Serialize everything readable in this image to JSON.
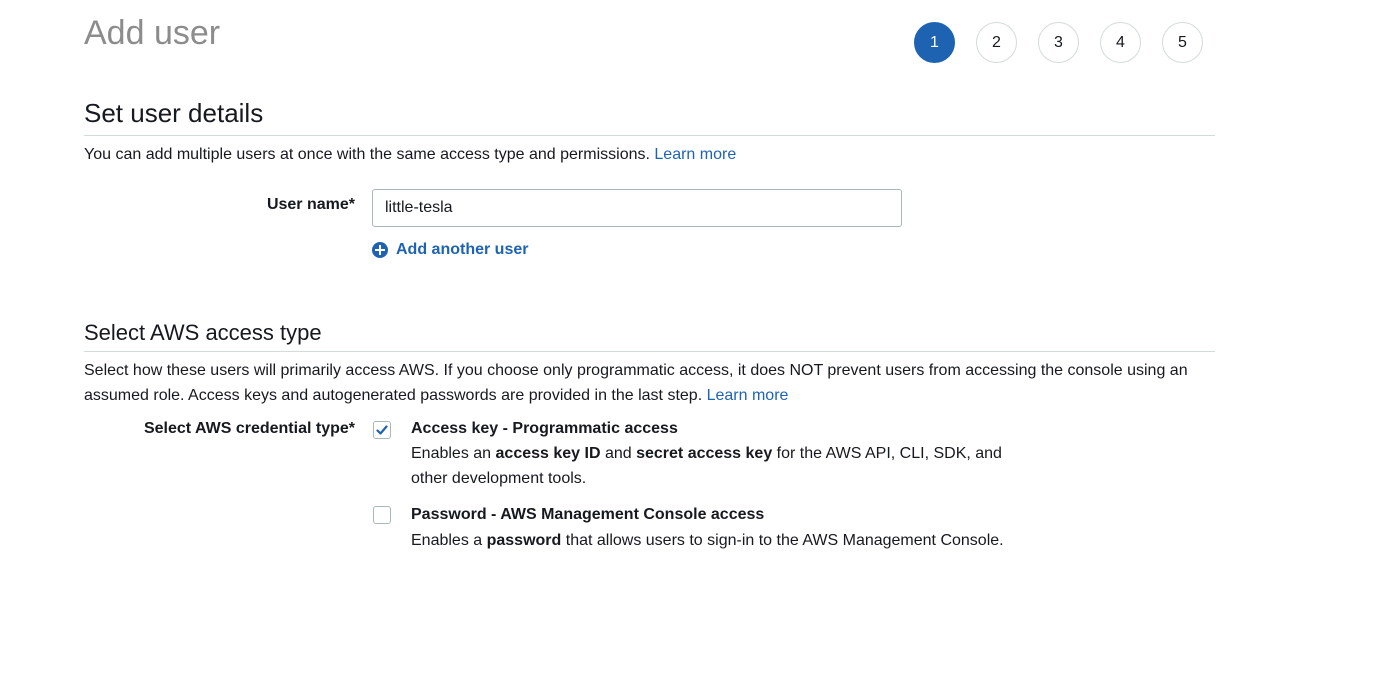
{
  "page": {
    "title": "Add user"
  },
  "steps": [
    "1",
    "2",
    "3",
    "4",
    "5"
  ],
  "active_step": 1,
  "details": {
    "heading": "Set user details",
    "description": "You can add multiple users at once with the same access type and permissions.",
    "learn_more": "Learn more",
    "user_name_label": "User name*",
    "user_name_value": "little-tesla",
    "add_another_user": "Add another user"
  },
  "access": {
    "heading": "Select AWS access type",
    "description": "Select how these users will primarily access AWS. If you choose only programmatic access, it does NOT prevent users from accessing the console using an assumed role. Access keys and autogenerated passwords are provided in the last step.",
    "learn_more": "Learn more",
    "credential_label": "Select AWS credential type*",
    "options": [
      {
        "title": "Access key - Programmatic access",
        "checked": true,
        "desc_1": "Enables an ",
        "desc_bold_1": "access key ID",
        "desc_2": " and ",
        "desc_bold_2": "secret access key",
        "desc_3": " for the AWS API, CLI, SDK, and",
        "desc_line2": "other development tools."
      },
      {
        "title": "Password - AWS Management Console access",
        "checked": false,
        "desc_1": "Enables a ",
        "desc_bold_1": "password",
        "desc_2": " that allows users to sign-in to the AWS Management Console."
      }
    ]
  },
  "colors": {
    "accent": "#1e63b2",
    "rule": "#d5dbdb",
    "title_gray": "#8c8c8c"
  }
}
